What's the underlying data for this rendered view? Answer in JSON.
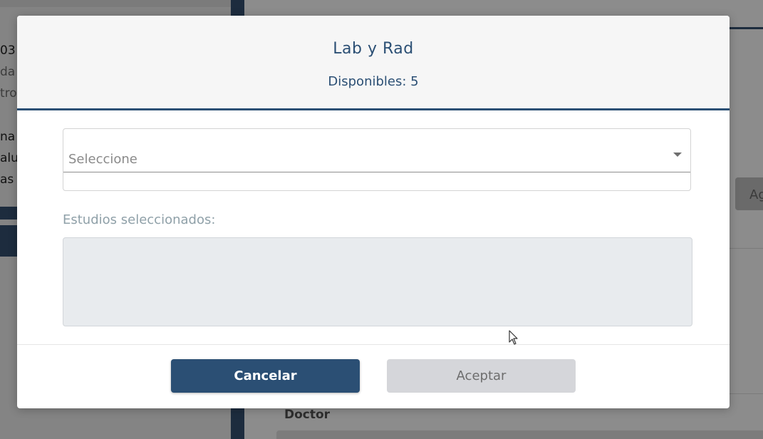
{
  "background": {
    "left_texts": [
      "03",
      "da",
      "tro",
      "na",
      "alu",
      "as"
    ],
    "right_button_label": "Ag",
    "doctor_label": "Doctor"
  },
  "modal": {
    "title": "Lab y Rad",
    "subtitle": "Disponibles: 5",
    "select_placeholder": "Seleccione",
    "selected_label": "Estudios seleccionados:",
    "cancel_label": "Cancelar",
    "accept_label": "Aceptar"
  },
  "colors": {
    "primary": "#2b4f74",
    "accept_disabled": "#d5d6da",
    "selected_area": "#e8ebee"
  },
  "icons": {
    "select_caret": "chevron-down-icon",
    "cursor": "mouse-pointer-icon"
  }
}
